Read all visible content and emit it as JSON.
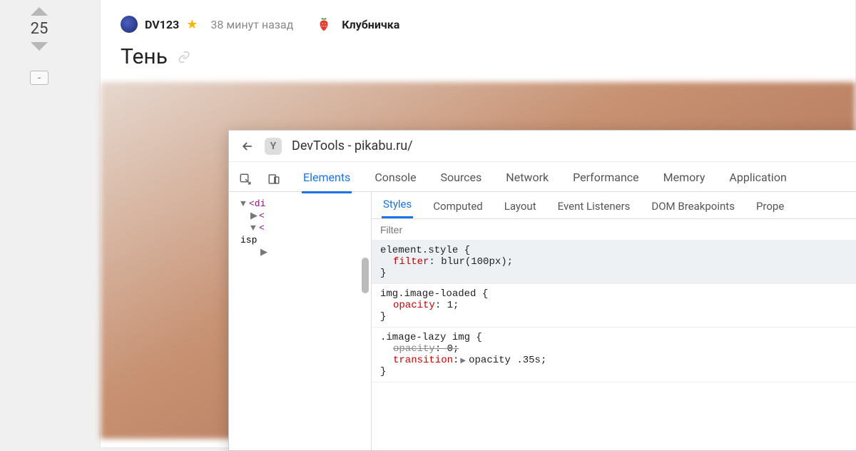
{
  "vote": {
    "score": "25",
    "minus": "-"
  },
  "post": {
    "username": "DV123",
    "time": "38 минут назад",
    "tag": "Клубничка",
    "title": "Тень"
  },
  "devtools": {
    "title": "DevTools - pikabu.ru/",
    "tabs": [
      "Elements",
      "Console",
      "Sources",
      "Network",
      "Performance",
      "Memory",
      "Application"
    ],
    "activeTab": "Elements",
    "dom": {
      "l1": "<di",
      "l2": "<",
      "l3": "<",
      "isp": "isp"
    },
    "subtabs": [
      "Styles",
      "Computed",
      "Layout",
      "Event Listeners",
      "DOM Breakpoints",
      "Prope"
    ],
    "activeSubtab": "Styles",
    "filterPlaceholder": "Filter",
    "rules": [
      {
        "selector": "element.style",
        "declarations": [
          {
            "prop": "filter",
            "val": "blur(100px)",
            "strike": false
          }
        ]
      },
      {
        "selector": "img.image-loaded",
        "declarations": [
          {
            "prop": "opacity",
            "val": "1",
            "strike": false
          }
        ]
      },
      {
        "selector": ".image-lazy img",
        "declarations": [
          {
            "prop": "opacity",
            "val": "0",
            "strike": true
          },
          {
            "prop": "transition",
            "val": "opacity .35s",
            "strike": false,
            "expandable": true
          }
        ]
      }
    ]
  }
}
